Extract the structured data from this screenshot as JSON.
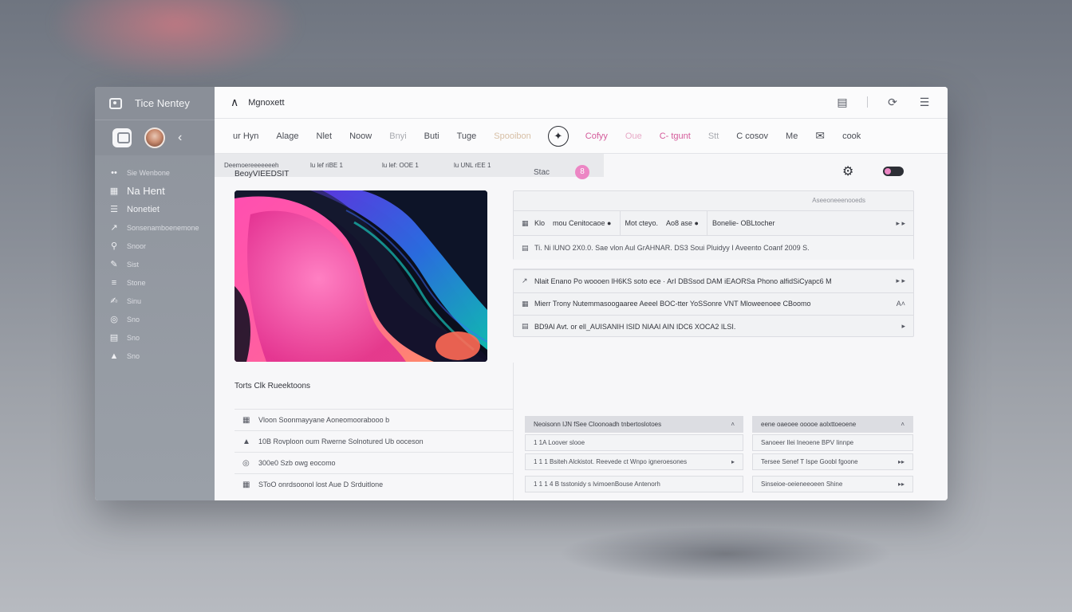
{
  "app": {
    "title": "Tice Nentey",
    "header_title": "Mgnoxett"
  },
  "sidebar": {
    "items": [
      {
        "label": "Sie Wenbone",
        "icon": "dots-icon",
        "style": "faint"
      },
      {
        "label": "Na Hent",
        "icon": "grid-icon",
        "style": "strong"
      },
      {
        "label": "Nonetiet",
        "icon": "list-icon",
        "style": "medium"
      },
      {
        "label": "Sonsenamboenemone",
        "icon": "link-icon",
        "style": "faint"
      },
      {
        "label": "Snoor",
        "icon": "search-icon",
        "style": "faint"
      },
      {
        "label": "Sist",
        "icon": "pen-icon",
        "style": "faint"
      },
      {
        "label": "Stone",
        "icon": "lines-icon",
        "style": "faint"
      },
      {
        "label": "Sinu",
        "icon": "edit-icon",
        "style": "faint"
      },
      {
        "label": "Sno",
        "icon": "globe-icon",
        "style": "faint"
      },
      {
        "label": "Sno",
        "icon": "doc-icon",
        "style": "faint"
      },
      {
        "label": "Sno",
        "icon": "user-icon",
        "style": "faint"
      }
    ]
  },
  "tabs": [
    {
      "label": "ur Hyn",
      "style": "normal"
    },
    {
      "label": "Alage",
      "style": "normal"
    },
    {
      "label": "Nlet",
      "style": "normal"
    },
    {
      "label": "Noow",
      "style": "normal"
    },
    {
      "label": "Bnyi",
      "style": "faint"
    },
    {
      "label": "Buti",
      "style": "normal"
    },
    {
      "label": "Tuge",
      "style": "normal"
    },
    {
      "label": "Spooibon",
      "style": "goldfaint"
    },
    {
      "label": "Cofyy",
      "style": "pink"
    },
    {
      "label": "Oue",
      "style": "pinkfaint"
    },
    {
      "label": "C- tgunt",
      "style": "pink"
    },
    {
      "label": "Stt",
      "style": "faint"
    },
    {
      "label": "C cosov",
      "style": "normal"
    },
    {
      "label": "Me",
      "style": "normal"
    },
    {
      "label": "cook",
      "style": "normal"
    }
  ],
  "content": {
    "section_title": "BeoyVIEEDSIT",
    "mid_label": "Stac",
    "pink_dot_label": "8",
    "recommendations_title": "Torts Clk Rueektoons",
    "recommendations": [
      {
        "icon": "grid-icon",
        "label": "Vloon Soonmayyane Aoneomoorabooo b"
      },
      {
        "icon": "user-icon",
        "label": "10B Rovploon oum Rwerne Solnotured Ub ooceson"
      },
      {
        "icon": "globe-icon",
        "label": "300e0 Szb owg eocomo"
      },
      {
        "icon": "grid-icon",
        "label": "SToO onrdsoonol lost Aue D Srduitlone"
      }
    ]
  },
  "table1": {
    "caption": "Aseeoneeenooeds",
    "rows": [
      {
        "icon": "grid-icon",
        "cells": [
          "Klo",
          "mou Cenitocaoe ●",
          "Mot cteyo.",
          "Ao8 ase ●",
          "Bonelie- OBLtocher"
        ],
        "end": "▸ ▸"
      },
      {
        "icon": "doc-icon",
        "cells": [
          "Ti. Ni lUNO 2X0.0. Sae vlon Aul GrAHNAR. DS3 Soui Pluidyy I Aveento Coanf 2009 S."
        ],
        "end": ""
      }
    ]
  },
  "table2": {
    "rows": [
      {
        "icon": "link-icon",
        "cells": [
          "Nlait Enano Po woooen lH6KS soto ece · ArI DBSsod DAM iEAORSa Phono  alfidSiCyapc6 M"
        ],
        "end": "▸ ▸"
      },
      {
        "icon": "grid-icon",
        "cells": [
          "Mierr Trony  Nutemmasoogaaree  Aeeel  BOC-tter YoSSonre  VNT Mloweenoee  CBoomo"
        ],
        "end": "A˄"
      },
      {
        "icon": "doc-icon",
        "cells": [
          "BD9Al Avt. or ell_AUISANIH ISID NIAAI AIN IDC6 XOCA2 ILSI."
        ],
        "end": "▸"
      }
    ]
  },
  "summary_row": {
    "cells": [
      "Deemoereeeeeeeh",
      "lu lef riBE 1",
      "lu lef: OOE 1",
      "lu UNL rEE 1"
    ]
  },
  "mini_left": [
    {
      "label": "Neoisonn      IJN fSee  Cloonoadh tnbertoslotoes",
      "end": "˄",
      "head": true
    },
    {
      "label": "1 1A  Loover slooe",
      "end": ""
    },
    {
      "label": "1 1 1  Bsiteh Alckistot. Reevede ct Wnpo igneroesones",
      "end": "▸"
    },
    {
      "label": "1 1 1 4  B tsstonidy s lvimoenBouse  Antenorh",
      "end": ""
    }
  ],
  "mini_right": [
    {
      "label": "eene oaeoee ooooe aolxttoeoene",
      "end": "˄",
      "head": true
    },
    {
      "label": "Sanoeer Ilei Ineoene  BPV Iinnpe",
      "end": ""
    },
    {
      "label": "Tersee Senef T Ispe Goobl fgoone",
      "end": "▸▸"
    },
    {
      "label": "Sinseioe-oeieneeoeen  Shine",
      "end": "▸▸"
    }
  ],
  "colors": {
    "accent_pink": "#ec86c4",
    "sidebar_bg": "#8e939c",
    "text_dark": "#2d2f36"
  }
}
